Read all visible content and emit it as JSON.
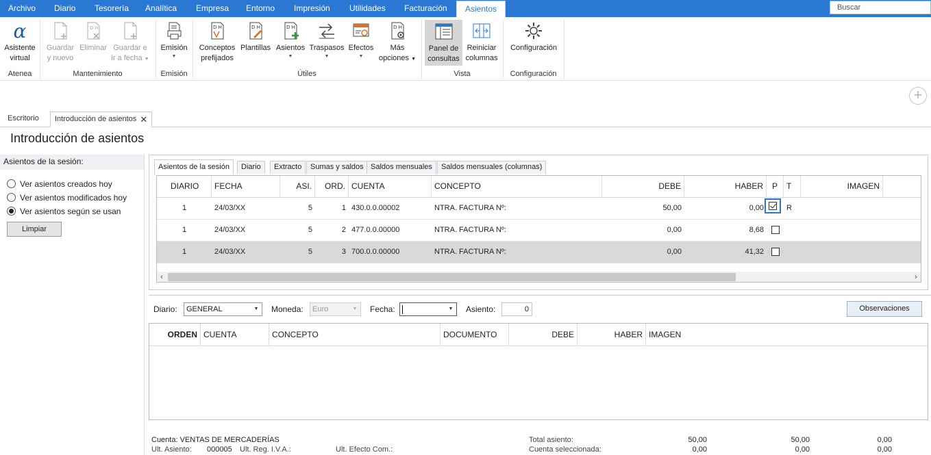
{
  "menu": {
    "items": [
      "Archivo",
      "Diario",
      "Tesorería",
      "Analítica",
      "Empresa",
      "Entorno",
      "Impresión",
      "Utilidades",
      "Facturación",
      "Asientos"
    ],
    "active": "Asientos",
    "search_placeholder": "Buscar"
  },
  "ribbon": {
    "buttons": [
      {
        "l1": "Asistente",
        "l2": "virtual"
      },
      {
        "l1": "Guardar",
        "l2": "y nuevo"
      },
      {
        "l1": "Eliminar",
        "l2": ""
      },
      {
        "l1": "Guardar e",
        "l2": "ir a fecha"
      },
      {
        "l1": "Emisión",
        "l2": ""
      },
      {
        "l1": "Conceptos",
        "l2": "prefijados"
      },
      {
        "l1": "Plantillas",
        "l2": ""
      },
      {
        "l1": "Asientos",
        "l2": ""
      },
      {
        "l1": "Traspasos",
        "l2": ""
      },
      {
        "l1": "Efectos",
        "l2": ""
      },
      {
        "l1": "Más",
        "l2": "opciones"
      },
      {
        "l1": "Panel de",
        "l2": "consultas"
      },
      {
        "l1": "Reiniciar",
        "l2": "columnas"
      },
      {
        "l1": "Configuración",
        "l2": ""
      }
    ],
    "groups": [
      "Atenea",
      "Mantenimiento",
      "Emisión",
      "Útiles",
      "Vista",
      "Configuración"
    ]
  },
  "doctabs": [
    "Escritorio",
    "Introducción de asientos"
  ],
  "page_title": "Introducción de asientos",
  "left_panel": {
    "header": "Asientos de la sesión:",
    "options": [
      "Ver asientos creados hoy",
      "Ver asientos modificados hoy",
      "Ver asientos según se usan"
    ],
    "selected_index": 2,
    "clear_button": "Limpiar"
  },
  "subtabs": [
    "Asientos de la sesión",
    "Diario",
    "Extracto",
    "Sumas y saldos",
    "Saldos mensuales",
    "Saldos mensuales (columnas)"
  ],
  "top_grid": {
    "headers": [
      "DIARIO",
      "FECHA",
      "ASI.",
      "ORD.",
      "CUENTA",
      "CONCEPTO",
      "DEBE",
      "HABER",
      "P",
      "T",
      "IMAGEN"
    ],
    "rows": [
      {
        "diario": "1",
        "fecha": "24/03/XX",
        "asi": "5",
        "ord": "1",
        "cuenta": "430.0.0.00002",
        "concepto": "NTRA. FACTURA Nº:",
        "debe": "50,00",
        "haber": "0,00",
        "p": true,
        "t": "R"
      },
      {
        "diario": "1",
        "fecha": "24/03/XX",
        "asi": "5",
        "ord": "2",
        "cuenta": "477.0.0.00000",
        "concepto": "NTRA. FACTURA Nº:",
        "debe": "0,00",
        "haber": "8,68",
        "p": false,
        "t": ""
      },
      {
        "diario": "1",
        "fecha": "24/03/XX",
        "asi": "5",
        "ord": "3",
        "cuenta": "700.0.0.00000",
        "concepto": "NTRA. FACTURA Nº:",
        "debe": "0,00",
        "haber": "41,32",
        "p": false,
        "t": ""
      }
    ]
  },
  "filters": {
    "diario_label": "Diario:",
    "diario_value": "GENERAL",
    "moneda_label": "Moneda:",
    "moneda_value": "Euro",
    "fecha_label": "Fecha:",
    "fecha_value": "",
    "asiento_label": "Asiento:",
    "asiento_value": "0",
    "observaciones_button": "Observaciones"
  },
  "bottom_grid": {
    "headers": [
      "ORDEN",
      "CUENTA",
      "CONCEPTO",
      "DOCUMENTO",
      "DEBE",
      "HABER",
      "IMAGEN"
    ]
  },
  "footer": {
    "cuenta": "Cuenta: VENTAS DE MERCADERÍAS",
    "ult_asiento_label": "Ult. Asiento:",
    "ult_asiento_value": "000005",
    "ult_reg_iva_label": "Ult. Reg. I.V.A.:",
    "ult_efecto_label": "Ult. Efecto Com.:",
    "total_asiento_label": "Total asiento:",
    "cuenta_sel_label": "Cuenta seleccionada:",
    "total_debe": "50,00",
    "total_haber": "50,00",
    "total_saldo": "0,00",
    "sel_debe": "0,00",
    "sel_haber": "0,00",
    "sel_saldo": "0,00"
  }
}
